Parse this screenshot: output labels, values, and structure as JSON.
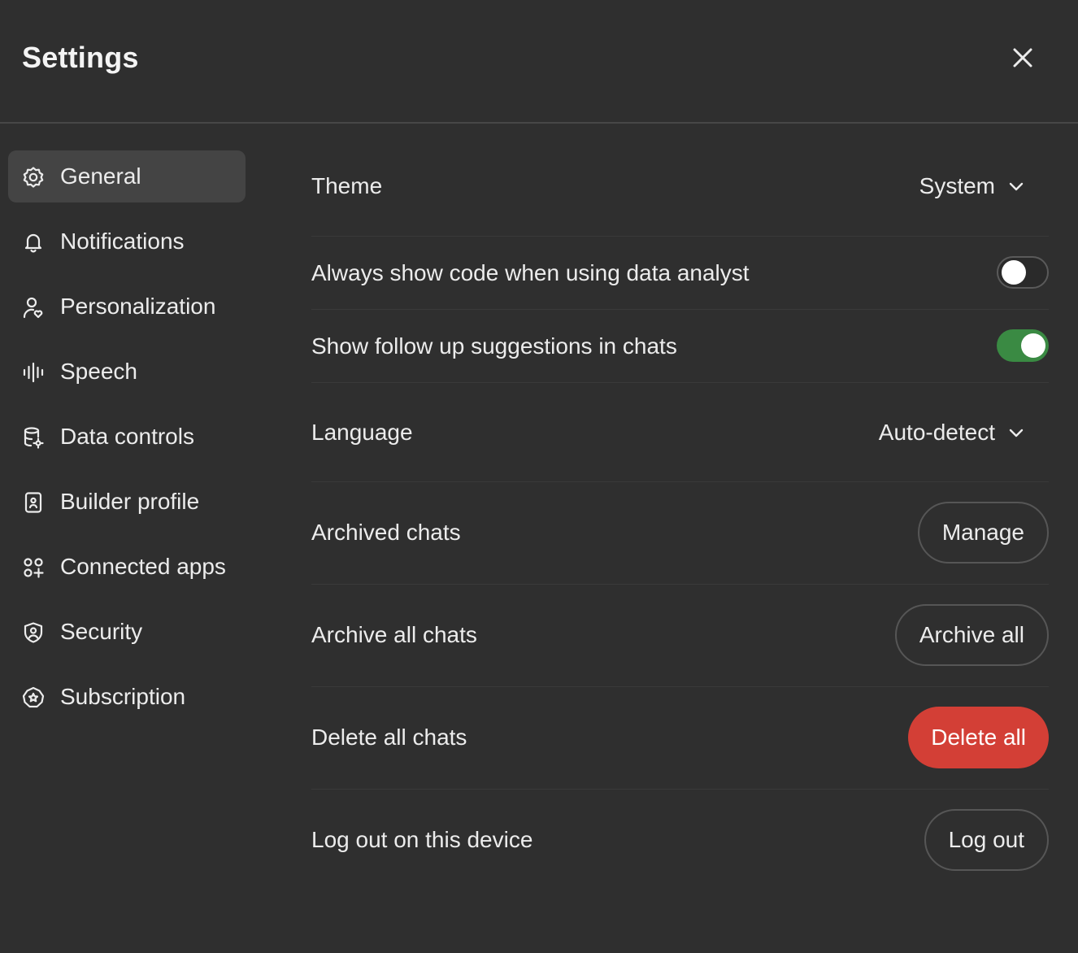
{
  "header": {
    "title": "Settings",
    "close_icon": "close-icon"
  },
  "sidebar": {
    "items": [
      {
        "label": "General",
        "icon": "gear-icon",
        "active": true
      },
      {
        "label": "Notifications",
        "icon": "bell-icon",
        "active": false
      },
      {
        "label": "Personalization",
        "icon": "person-heart-icon",
        "active": false
      },
      {
        "label": "Speech",
        "icon": "waveform-icon",
        "active": false
      },
      {
        "label": "Data controls",
        "icon": "database-gear-icon",
        "active": false
      },
      {
        "label": "Builder profile",
        "icon": "id-badge-icon",
        "active": false
      },
      {
        "label": "Connected apps",
        "icon": "apps-plus-icon",
        "active": false
      },
      {
        "label": "Security",
        "icon": "shield-user-icon",
        "active": false
      },
      {
        "label": "Subscription",
        "icon": "badge-star-icon",
        "active": false
      }
    ]
  },
  "settings": {
    "theme": {
      "label": "Theme",
      "value": "System"
    },
    "show_code": {
      "label": "Always show code when using data analyst",
      "enabled": false
    },
    "follow_up": {
      "label": "Show follow up suggestions in chats",
      "enabled": true
    },
    "language": {
      "label": "Language",
      "value": "Auto-detect"
    },
    "archived_chats": {
      "label": "Archived chats",
      "button": "Manage"
    },
    "archive_all": {
      "label": "Archive all chats",
      "button": "Archive all"
    },
    "delete_all": {
      "label": "Delete all chats",
      "button": "Delete all"
    },
    "log_out": {
      "label": "Log out on this device",
      "button": "Log out"
    }
  },
  "colors": {
    "background": "#2f2f2f",
    "active_nav": "#444444",
    "toggle_on": "#3a8a43",
    "danger": "#d33f36"
  }
}
